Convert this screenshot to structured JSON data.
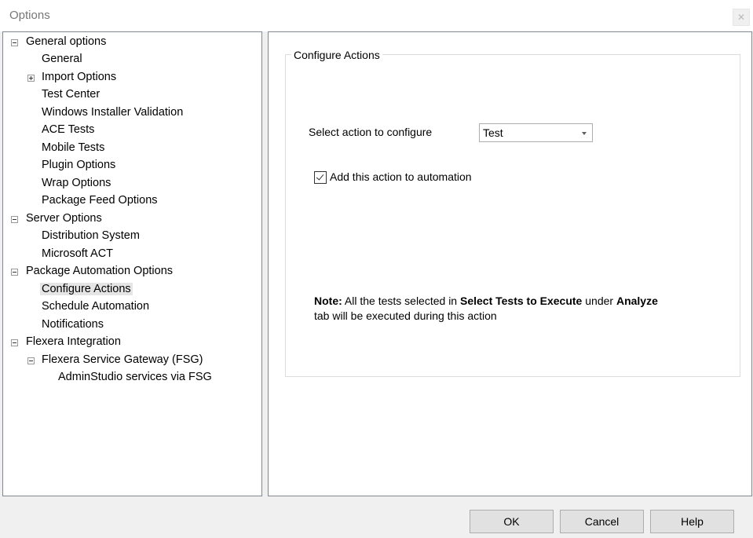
{
  "window": {
    "title": "Options",
    "close_glyph": "✕"
  },
  "tree": {
    "items": [
      {
        "label": "General options",
        "expander": "minus"
      },
      {
        "label": "General"
      },
      {
        "label": "Import Options",
        "expander": "plus"
      },
      {
        "label": "Test Center"
      },
      {
        "label": "Windows Installer Validation"
      },
      {
        "label": "ACE Tests"
      },
      {
        "label": "Mobile Tests"
      },
      {
        "label": "Plugin Options"
      },
      {
        "label": "Wrap Options"
      },
      {
        "label": "Package Feed Options"
      },
      {
        "label": "Server Options",
        "expander": "minus"
      },
      {
        "label": "Distribution System"
      },
      {
        "label": "Microsoft ACT"
      },
      {
        "label": "Package Automation Options",
        "expander": "minus"
      },
      {
        "label": "Configure Actions",
        "selected": true
      },
      {
        "label": "Schedule Automation"
      },
      {
        "label": "Notifications"
      },
      {
        "label": "Flexera Integration",
        "expander": "minus"
      },
      {
        "label": "Flexera Service Gateway (FSG)",
        "expander": "minus"
      },
      {
        "label": "AdminStudio services via FSG"
      }
    ]
  },
  "configure": {
    "group_title": "Configure Actions",
    "select_label": "Select action to configure",
    "select_value": "Test",
    "checkbox_label": "Add this action to automation",
    "checkbox_checked": true,
    "note": {
      "prefix": "Note:",
      "text1": " All the tests selected in ",
      "bold1": "Select Tests to Execute",
      "text2": " under ",
      "bold2": "Analyze",
      "line2": "tab will be executed during this action"
    }
  },
  "buttons": {
    "ok": "OK",
    "cancel": "Cancel",
    "help": "Help"
  }
}
